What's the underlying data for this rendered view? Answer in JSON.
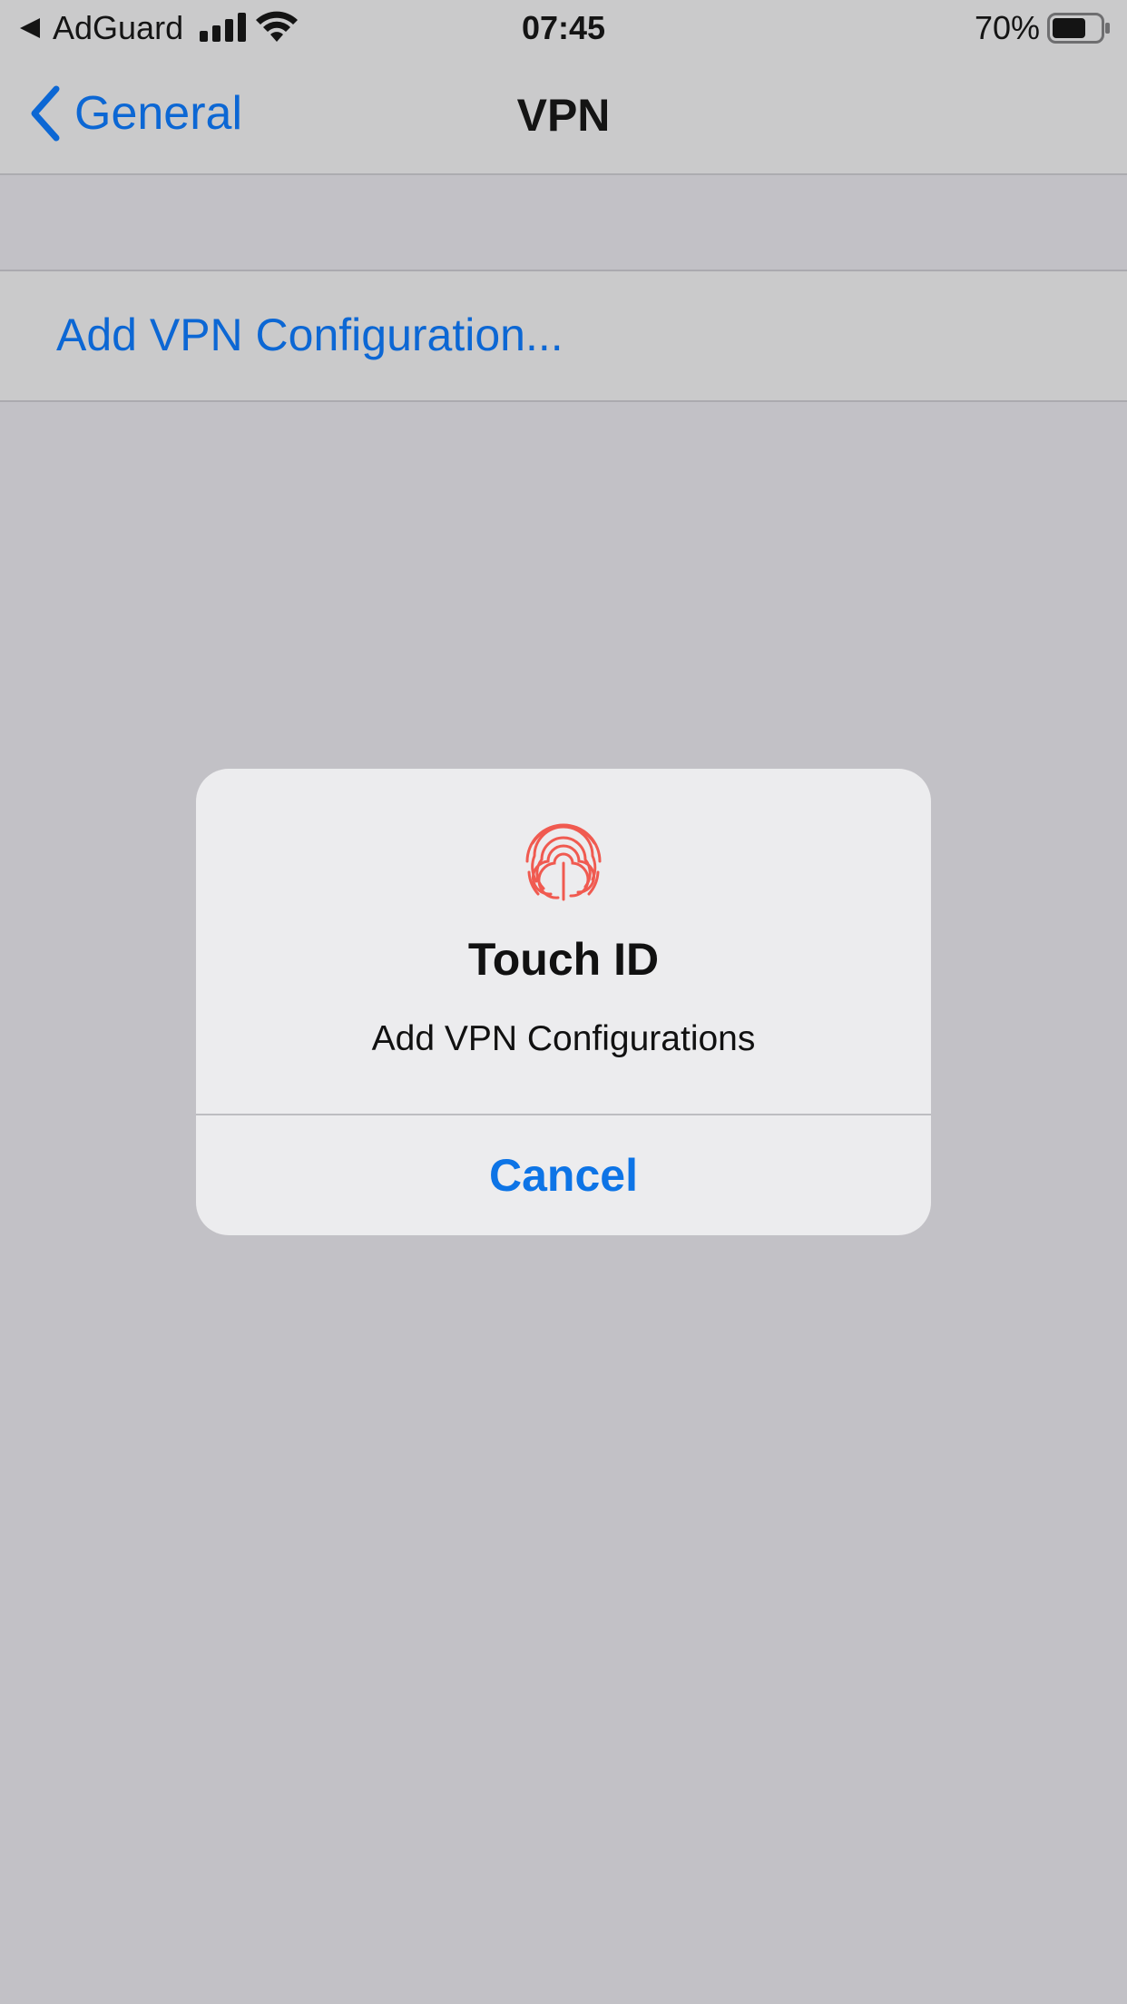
{
  "status_bar": {
    "back_app": "AdGuard",
    "time": "07:45",
    "battery_percent": "70%",
    "battery_level": 0.7,
    "signal_bars": 4
  },
  "nav": {
    "back_label": "General",
    "title": "VPN"
  },
  "settings": {
    "add_vpn_label": "Add VPN Configuration..."
  },
  "alert": {
    "icon": "fingerprint-icon",
    "title": "Touch ID",
    "message": "Add VPN Configurations",
    "cancel_label": "Cancel"
  },
  "colors": {
    "accent": "#0c67d4",
    "fingerprint": "#f05a50",
    "background": "#c2c1c6"
  }
}
